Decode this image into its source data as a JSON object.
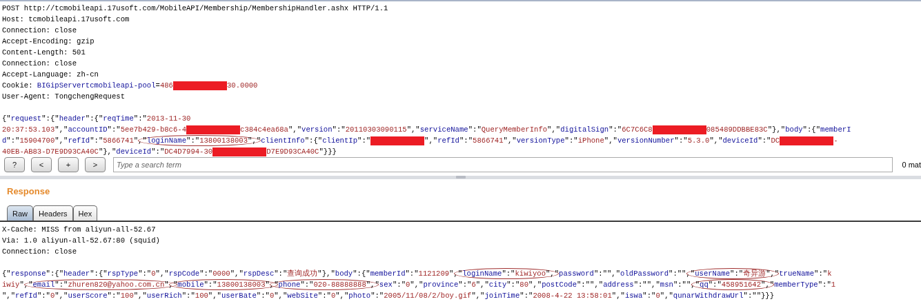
{
  "request": {
    "lines": [
      {
        "kind": "plain",
        "segments": [
          {
            "kind": "text",
            "text": "POST http://tcmobileapi.17usoft.com/MobileAPI/Membership/MembershipHandler.ashx HTTP/1.1"
          }
        ]
      },
      {
        "kind": "plain",
        "segments": [
          {
            "kind": "text",
            "text": "Host: tcmobileapi.17usoft.com"
          }
        ]
      },
      {
        "kind": "plain",
        "segments": [
          {
            "kind": "text",
            "text": "Connection: close"
          }
        ]
      },
      {
        "kind": "plain",
        "segments": [
          {
            "kind": "text",
            "text": "Accept-Encoding: gzip"
          }
        ]
      },
      {
        "kind": "plain",
        "segments": [
          {
            "kind": "text",
            "text": "Content-Length: 501"
          }
        ]
      },
      {
        "kind": "plain",
        "segments": [
          {
            "kind": "text",
            "text": "Connection: close"
          }
        ]
      },
      {
        "kind": "plain",
        "segments": [
          {
            "kind": "text",
            "text": "Accept-Language: zh-cn"
          }
        ]
      },
      {
        "kind": "plain",
        "segments": [
          {
            "kind": "text",
            "text": "Cookie: "
          },
          {
            "kind": "cookie-name",
            "text": "BIGipServertcmobileapi-pool"
          },
          {
            "kind": "text",
            "text": "="
          },
          {
            "kind": "cookie-value",
            "text": "486"
          },
          {
            "kind": "redacted"
          },
          {
            "kind": "cookie-value",
            "text": "30.0000"
          }
        ]
      },
      {
        "kind": "plain",
        "segments": [
          {
            "kind": "text",
            "text": "User-Agent: TongchengRequest"
          }
        ]
      },
      {
        "kind": "blank"
      },
      {
        "kind": "json",
        "segments": [
          {
            "kind": "text",
            "text": "{\"request\":{\"header\":{\"reqTime\":\"2013-11-30"
          }
        ]
      },
      {
        "kind": "json",
        "segments": [
          {
            "kind": "text",
            "text": "20:37:53.103\",\"accountID\":\"5ee7b429-b8c6-4"
          },
          {
            "kind": "redacted"
          },
          {
            "kind": "text",
            "text": "c384c4ea68a\",\"version\":\"20110303090115\",\"serviceName\":\"QueryMemberInfo\",\"digitalSign\":\"6C7C6C8"
          },
          {
            "kind": "redacted"
          },
          {
            "kind": "text",
            "text": "085489DDBBE83C\"},\"body\":{\"memberI"
          }
        ]
      },
      {
        "kind": "json",
        "segments": [
          {
            "kind": "text",
            "text": "d\":\"15904700\",\"refId\":\"5866741\","
          },
          {
            "kind": "circled",
            "text": "\"loginName\":\"13800138003\","
          },
          {
            "kind": "text",
            "text": "\"clientInfo\":{\"clientIp\":\""
          },
          {
            "kind": "redacted"
          },
          {
            "kind": "text",
            "text": "\",\"refId\":\"5866741\",\"versionType\":\"iPhone\",\"versionNumber\":\"5.3.0\",\"deviceId\":\"DC"
          },
          {
            "kind": "redacted"
          },
          {
            "kind": "text",
            "text": "-"
          }
        ]
      },
      {
        "kind": "json",
        "segments": [
          {
            "kind": "text",
            "text": "40EB-AB83-D7E9D93CA40C\"},\"deviceId\":\"DC4D7994-30"
          },
          {
            "kind": "redacted"
          },
          {
            "kind": "text",
            "text": "D7E9D93CA40C\"}}}"
          }
        ]
      }
    ]
  },
  "search_bar": {
    "buttons": [
      "?",
      "<",
      "+",
      ">"
    ],
    "placeholder": "Type a search term",
    "match_count": "0 mat"
  },
  "response": {
    "title": "Response",
    "tabs": [
      {
        "label": "Raw",
        "selected": true
      },
      {
        "label": "Headers",
        "selected": false
      },
      {
        "label": "Hex",
        "selected": false
      }
    ],
    "lines": [
      {
        "kind": "plain",
        "segments": [
          {
            "kind": "text",
            "text": "X-Cache: MISS from aliyun-all-52.67"
          }
        ]
      },
      {
        "kind": "plain",
        "segments": [
          {
            "kind": "text",
            "text": "Via: 1.0 aliyun-all-52.67:80 (squid)"
          }
        ]
      },
      {
        "kind": "plain",
        "segments": [
          {
            "kind": "text",
            "text": "Connection: close"
          }
        ]
      },
      {
        "kind": "blank"
      },
      {
        "kind": "json",
        "segments": [
          {
            "kind": "text",
            "text": "{\"response\":{\"header\":{\"rspType\":\"0\",\"rspCode\":\"0000\",\"rspDesc\":\"查询成功\"},\"body\":{\"memberId\":\"1121209\","
          },
          {
            "kind": "circled",
            "text": "\"loginName\":\"kiwiyoo\","
          },
          {
            "kind": "text",
            "text": "\"password\":\"\",\"oldPassword\":\"\","
          },
          {
            "kind": "circled",
            "text": "\"userName\":\"奇异游\","
          },
          {
            "kind": "text",
            "text": "\"trueName\":\"k"
          }
        ]
      },
      {
        "kind": "json",
        "segments": [
          {
            "kind": "text",
            "text": "iwiy\","
          },
          {
            "kind": "circled",
            "text": "\"email\":\"zhuren820@yahoo.com.cn\","
          },
          {
            "kind": "circled",
            "text": "\"mobile\":\"13800138003\","
          },
          {
            "kind": "circled",
            "text": "\"phone\":\"020-88888888\","
          },
          {
            "kind": "text",
            "text": "\"sex\":\"0\",\"province\":\"6\",\"city\":\"80\",\"postCode\":\"\",\"address\":\"\",\"msn\":\"\","
          },
          {
            "kind": "circled",
            "text": "\"qq\":\"458951642\","
          },
          {
            "kind": "text",
            "text": "\"memberType\":\"1"
          }
        ]
      },
      {
        "kind": "json",
        "segments": [
          {
            "kind": "text",
            "text": "\",\"refId\":\"0\",\"userScore\":\"100\",\"userRich\":\"100\",\"userBate\":\"0\",\"webSite\":\"0\",\"photo\":\"2005/11/08/2/boy.gif\",\"joinTime\":\"2008-4-22 13:58:01\",\"iswa\":\"0\",\"qunarWithdrawUrl\":\"\"}}}"
          }
        ]
      }
    ]
  }
}
